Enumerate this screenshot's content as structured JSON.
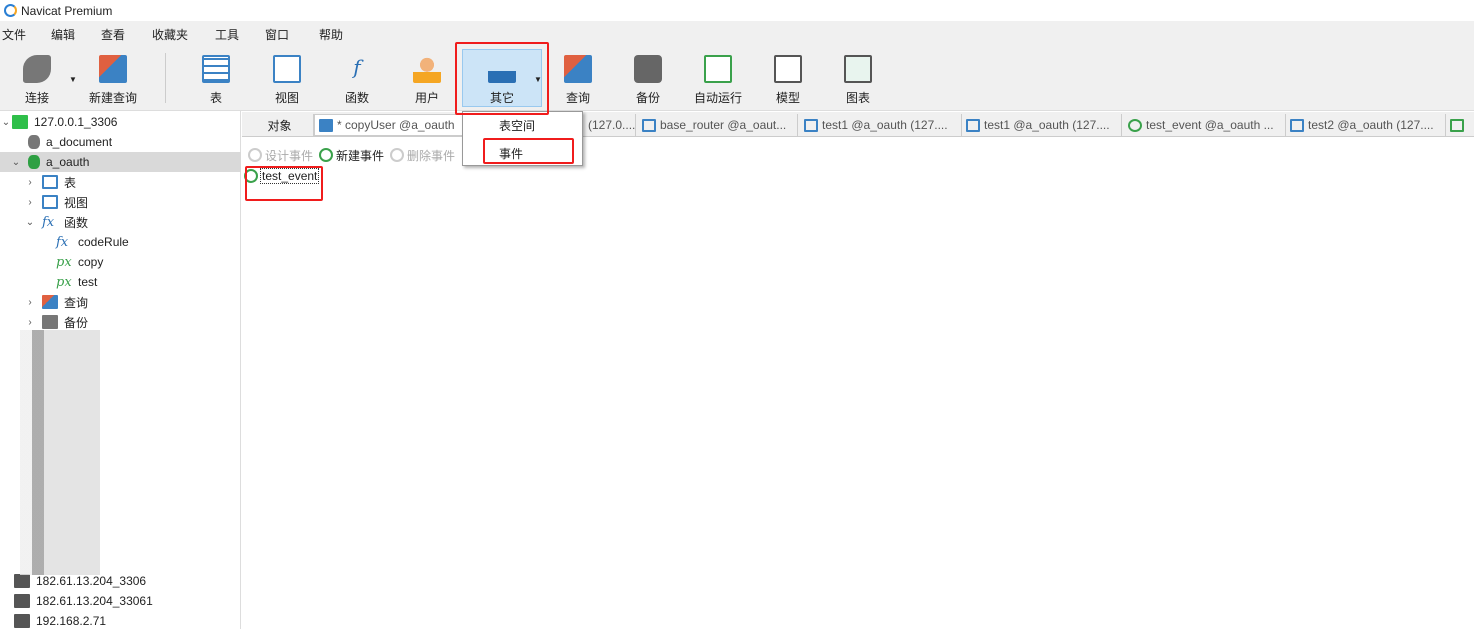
{
  "app": {
    "title": "Navicat Premium"
  },
  "menu": [
    "文件",
    "编辑",
    "查看",
    "收藏夹",
    "工具",
    "窗口",
    "帮助"
  ],
  "toolbar": [
    {
      "label": "连接",
      "icon": "plug-add-icon",
      "dropdown": true
    },
    {
      "label": "新建查询",
      "icon": "new-query-icon"
    },
    {
      "label": "表",
      "icon": "table-icon"
    },
    {
      "label": "视图",
      "icon": "view-icon"
    },
    {
      "label": "函数",
      "icon": "function-icon"
    },
    {
      "label": "用户",
      "icon": "user-icon"
    },
    {
      "label": "其它",
      "icon": "tools-icon",
      "dropdown": true,
      "selected": true
    },
    {
      "label": "查询",
      "icon": "query-icon"
    },
    {
      "label": "备份",
      "icon": "backup-icon"
    },
    {
      "label": "自动运行",
      "icon": "schedule-icon"
    },
    {
      "label": "模型",
      "icon": "model-icon"
    },
    {
      "label": "图表",
      "icon": "chart-icon"
    }
  ],
  "dropdown": {
    "items": [
      "表空间",
      "事件"
    ]
  },
  "sidebar": {
    "items": [
      {
        "label": "127.0.0.1_3306"
      },
      {
        "label": "a_document"
      },
      {
        "label": "a_oauth"
      },
      {
        "label": "表"
      },
      {
        "label": "视图"
      },
      {
        "label": "函数"
      },
      {
        "label": "codeRule"
      },
      {
        "label": "copy"
      },
      {
        "label": "test"
      },
      {
        "label": "查询"
      },
      {
        "label": "备份"
      }
    ],
    "connections": [
      "182.61.13.204_3306",
      "182.61.13.204_33061",
      "192.168.2.71"
    ]
  },
  "tabs": [
    "对象",
    "* copyUser @a_oauth",
    "(127.0....",
    "base_router @a_oaut...",
    "test1 @a_oauth (127....",
    "test1 @a_oauth (127....",
    "test_event @a_oauth ...",
    "test2 @a_oauth (127....",
    ""
  ],
  "subtoolbar": {
    "design": "设计事件",
    "new": "新建事件",
    "delete": "删除事件"
  },
  "objects": [
    "test_event"
  ],
  "colors": {
    "highlight": "#f01c1c",
    "selected": "#cce4f7"
  }
}
